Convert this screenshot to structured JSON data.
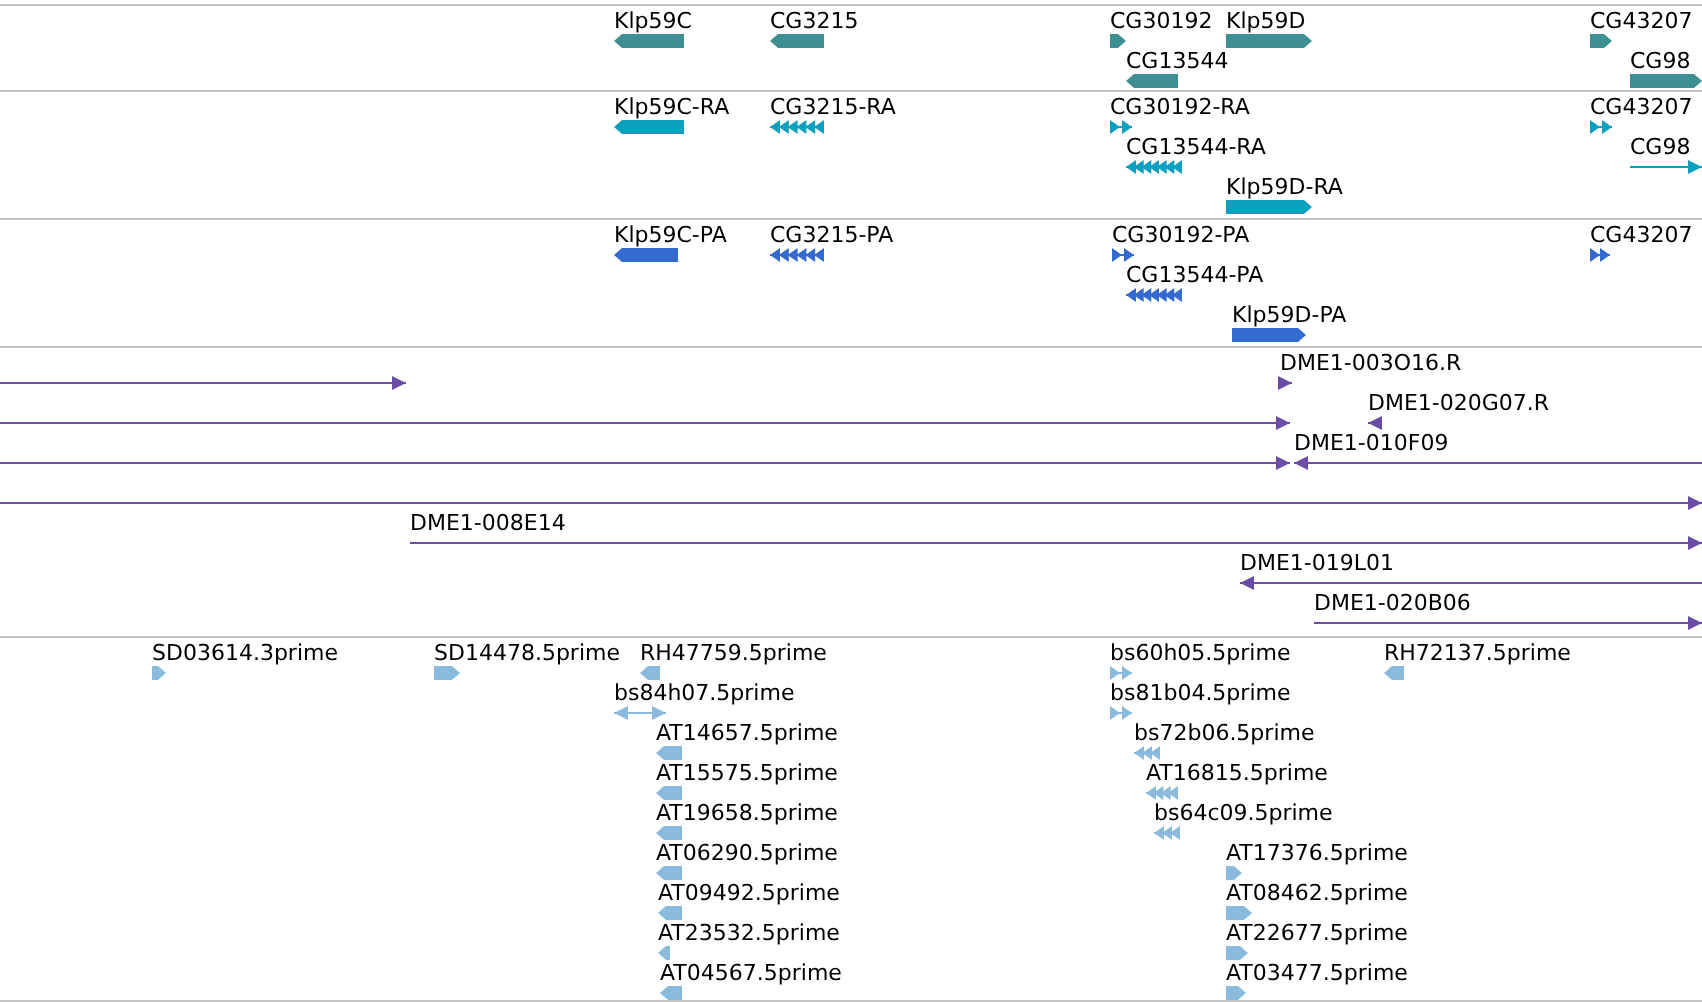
{
  "tracks": [
    {
      "color": "#3d8f91",
      "features": [
        {
          "label": "Klp59C",
          "reverse": true,
          "kind": "block"
        },
        {
          "label": "CG3215",
          "reverse": true,
          "kind": "block"
        },
        {
          "label": "CG30192",
          "reverse": false,
          "kind": "block"
        },
        {
          "label": "Klp59D",
          "reverse": false,
          "kind": "block"
        },
        {
          "label": "CG43207",
          "reverse": false,
          "kind": "block"
        },
        {
          "label": "CG13544",
          "reverse": true,
          "kind": "block"
        },
        {
          "label": "CG98",
          "reverse": false,
          "kind": "block"
        }
      ]
    },
    {
      "color": "#0b9fc0",
      "features": [
        {
          "label": "Klp59C-RA",
          "reverse": true,
          "kind": "block"
        },
        {
          "label": "CG3215-RA",
          "reverse": true,
          "kind": "segmented"
        },
        {
          "label": "CG30192-RA",
          "reverse": false,
          "kind": "segmented"
        },
        {
          "label": "CG43207",
          "reverse": false,
          "kind": "segmented"
        },
        {
          "label": "CG13544-RA",
          "reverse": true,
          "kind": "segmented"
        },
        {
          "label": "CG98",
          "reverse": false,
          "kind": "line"
        },
        {
          "label": "Klp59D-RA",
          "reverse": false,
          "kind": "block"
        }
      ]
    },
    {
      "color": "#3469cf",
      "features": [
        {
          "label": "Klp59C-PA",
          "reverse": true,
          "kind": "block"
        },
        {
          "label": "CG3215-PA",
          "reverse": true,
          "kind": "segmented"
        },
        {
          "label": "CG30192-PA",
          "reverse": false,
          "kind": "segmented"
        },
        {
          "label": "CG43207",
          "reverse": false,
          "kind": "segmented"
        },
        {
          "label": "CG13544-PA",
          "reverse": true,
          "kind": "segmented"
        },
        {
          "label": "Klp59D-PA",
          "reverse": false,
          "kind": "block"
        }
      ]
    },
    {
      "color": "#6a4ca8",
      "features": [
        {
          "reverse": false,
          "kind": "line"
        },
        {
          "label": "DME1-003O16.R",
          "reverse": false,
          "kind": "line"
        },
        {
          "reverse": false,
          "kind": "line"
        },
        {
          "label": "DME1-020G07.R",
          "reverse": true,
          "kind": "line"
        },
        {
          "reverse": false,
          "kind": "line"
        },
        {
          "label": "DME1-010F09",
          "reverse": true,
          "kind": "line"
        },
        {
          "reverse": false,
          "kind": "line"
        },
        {
          "label": "DME1-008E14",
          "reverse": false,
          "kind": "line"
        },
        {
          "label": "DME1-019L01",
          "reverse": true,
          "kind": "line"
        },
        {
          "label": "DME1-020B06",
          "reverse": false,
          "kind": "line"
        }
      ]
    },
    {
      "color": "#8bbbdc",
      "features": [
        {
          "label": "SD03614.3prime",
          "reverse": false,
          "kind": "block"
        },
        {
          "label": "SD14478.5prime",
          "reverse": false,
          "kind": "block"
        },
        {
          "label": "RH47759.5prime",
          "reverse": true,
          "kind": "block"
        },
        {
          "label": "bs60h05.5prime",
          "reverse": false,
          "kind": "segmented"
        },
        {
          "label": "RH72137.5prime",
          "reverse": true,
          "kind": "block"
        },
        {
          "label": "bs84h07.5prime",
          "kind": "double_line"
        },
        {
          "label": "bs81b04.5prime",
          "reverse": false,
          "kind": "segmented"
        },
        {
          "label": "AT14657.5prime",
          "reverse": true,
          "kind": "block"
        },
        {
          "label": "bs72b06.5prime",
          "reverse": true,
          "kind": "segmented"
        },
        {
          "label": "AT15575.5prime",
          "reverse": true,
          "kind": "block"
        },
        {
          "label": "AT16815.5prime",
          "reverse": true,
          "kind": "segmented"
        },
        {
          "label": "AT19658.5prime",
          "reverse": true,
          "kind": "block"
        },
        {
          "label": "bs64c09.5prime",
          "reverse": true,
          "kind": "segmented"
        },
        {
          "label": "AT06290.5prime",
          "reverse": true,
          "kind": "block"
        },
        {
          "label": "AT17376.5prime",
          "reverse": false,
          "kind": "block"
        },
        {
          "label": "AT09492.5prime",
          "reverse": true,
          "kind": "block"
        },
        {
          "label": "AT08462.5prime",
          "reverse": false,
          "kind": "block"
        },
        {
          "label": "AT23532.5prime",
          "reverse": true,
          "kind": "block"
        },
        {
          "label": "AT22677.5prime",
          "reverse": false,
          "kind": "block"
        },
        {
          "label": "AT04567.5prime",
          "reverse": true,
          "kind": "block"
        },
        {
          "label": "AT03477.5prime",
          "reverse": false,
          "kind": "block"
        }
      ]
    }
  ]
}
